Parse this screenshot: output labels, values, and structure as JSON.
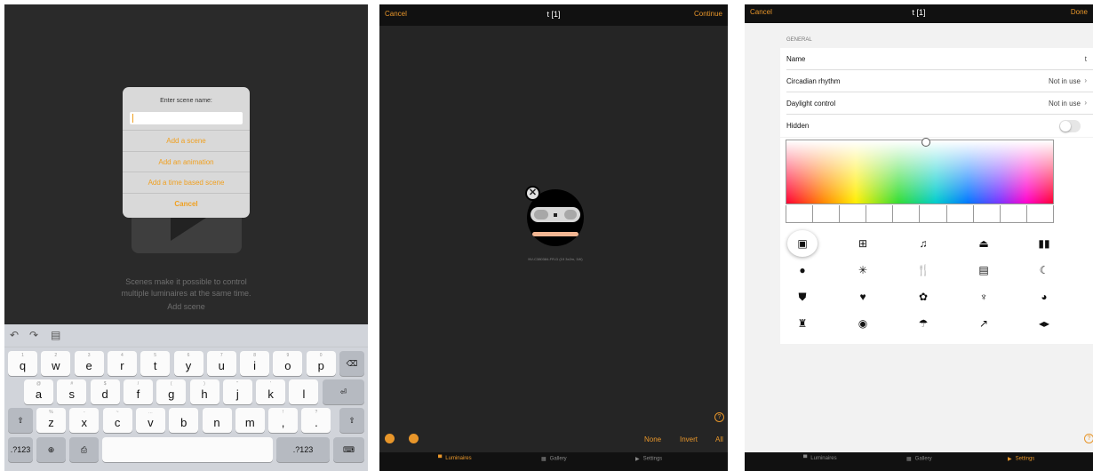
{
  "screen1": {
    "dialog": {
      "title": "Enter scene name:",
      "input_value": "",
      "add_scene": "Add a scene",
      "add_animation": "Add an animation",
      "add_time_based": "Add a time based scene",
      "cancel": "Cancel"
    },
    "hint_line1": "Scenes make it possible to control",
    "hint_line2": "multiple luminaires at the same time.",
    "add_scene_link": "Add scene",
    "keyboard": {
      "row1": [
        [
          "1",
          "q"
        ],
        [
          "2",
          "w"
        ],
        [
          "3",
          "e"
        ],
        [
          "4",
          "r"
        ],
        [
          "5",
          "t"
        ],
        [
          "6",
          "y"
        ],
        [
          "7",
          "u"
        ],
        [
          "8",
          "i"
        ],
        [
          "9",
          "o"
        ],
        [
          "0",
          "p"
        ]
      ],
      "row2": [
        [
          "@",
          "a"
        ],
        [
          "#",
          "s"
        ],
        [
          "$",
          "d"
        ],
        [
          "/",
          "f"
        ],
        [
          "(",
          "g"
        ],
        [
          ")",
          "h"
        ],
        [
          "\"",
          "j"
        ],
        [
          "'",
          "k"
        ],
        [
          "",
          "l"
        ]
      ],
      "row3": [
        [
          "%",
          "z"
        ],
        [
          "-",
          "x"
        ],
        [
          "~",
          "c"
        ],
        [
          "…",
          "v"
        ],
        [
          "",
          "b"
        ],
        [
          "",
          "n"
        ],
        [
          "",
          "m"
        ],
        [
          "!",
          ","
        ],
        [
          "?",
          "."
        ]
      ],
      "numbers_label": ".?123"
    }
  },
  "screen2": {
    "cancel": "Cancel",
    "title": "t [1]",
    "continue": "Continue",
    "luminaire_label": "NV-C380384-FR-D (19 3x2m, 1W)",
    "close_glyph": "✕",
    "help_glyph": "?",
    "select_none": "None",
    "select_invert": "Invert",
    "select_all": "All",
    "tabs": [
      {
        "label": "Luminaires",
        "icon": "lamp-icon",
        "active": true
      },
      {
        "label": "Gallery",
        "icon": "gallery-icon",
        "active": false
      },
      {
        "label": "Settings",
        "icon": "settings-icon",
        "active": false
      }
    ]
  },
  "screen3": {
    "cancel": "Cancel",
    "title": "t [1]",
    "done": "Done",
    "section": "GENERAL",
    "rows": {
      "name_label": "Name",
      "name_value": "t",
      "circadian_label": "Circadian rhythm",
      "circadian_value": "Not in use",
      "daylight_label": "Daylight control",
      "daylight_value": "Not in use",
      "hidden_label": "Hidden",
      "hidden_on": false
    },
    "icons": [
      {
        "name": "film-icon",
        "glyph": "▣",
        "selected": true
      },
      {
        "name": "presentation-icon",
        "glyph": "⊞"
      },
      {
        "name": "music-note-icon",
        "glyph": "♫"
      },
      {
        "name": "ship-icon",
        "glyph": "⏏"
      },
      {
        "name": "book-icon",
        "glyph": "▮▮"
      },
      {
        "name": "clock-icon",
        "glyph": "●"
      },
      {
        "name": "sun-icon",
        "glyph": "✳"
      },
      {
        "name": "cutlery-icon",
        "glyph": "🍴"
      },
      {
        "name": "bed-icon",
        "glyph": "▤"
      },
      {
        "name": "moon-icon",
        "glyph": "☾"
      },
      {
        "name": "mask-icon",
        "glyph": "⛊"
      },
      {
        "name": "heart-icon",
        "glyph": "♥"
      },
      {
        "name": "gift-icon",
        "glyph": "✿"
      },
      {
        "name": "wine-glass-icon",
        "glyph": "♆"
      },
      {
        "name": "palette-icon",
        "glyph": "◕"
      },
      {
        "name": "person-icon",
        "glyph": "♜"
      },
      {
        "name": "location-pin-icon",
        "glyph": "◉"
      },
      {
        "name": "umbrella-icon",
        "glyph": "☂"
      },
      {
        "name": "hammer-icon",
        "glyph": "↗"
      },
      {
        "name": "dumbbell-icon",
        "glyph": "◂▸"
      }
    ],
    "help_glyph": "?",
    "tabs": [
      {
        "label": "Luminaires",
        "icon": "lamp-icon",
        "active": false
      },
      {
        "label": "Gallery",
        "icon": "gallery-icon",
        "active": false
      },
      {
        "label": "Settings",
        "icon": "settings-icon",
        "active": true
      }
    ]
  },
  "colors": {
    "accent": "#e8962a",
    "dark_bg": "#252525",
    "light_bg": "#f2f2f2"
  }
}
